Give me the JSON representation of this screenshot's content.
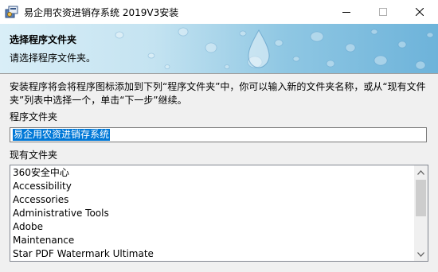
{
  "window": {
    "title": "易企用农资进销存系统 2019V3安装"
  },
  "header": {
    "title": "选择程序文件夹",
    "subtitle": "请选择程序文件夹。"
  },
  "body": {
    "instructions": "安装程序将会将程序图标添加到下列“程序文件夹”中，你可以输入新的文件夹名称，或从“现有文件夹”列表中选择一个，单击“下一步”继续。",
    "program_folder_label": "程序文件夹",
    "program_folder_value": "易企用农资进销存系统",
    "existing_folders_label": "现有文件夹",
    "existing_folders": [
      "360安全中心",
      "Accessibility",
      "Accessories",
      "Administrative Tools",
      "Adobe",
      "Maintenance",
      "Star PDF Watermark Ultimate"
    ]
  },
  "icons": {
    "app": "installer-icon",
    "minimize": "minimize-icon",
    "maximize": "maximize-icon",
    "close": "close-icon",
    "scroll_up": "scroll-up-icon",
    "scroll_down": "scroll-down-icon"
  },
  "colors": {
    "selection": "#0078d7",
    "header_gradient_end": "#6db3da"
  }
}
